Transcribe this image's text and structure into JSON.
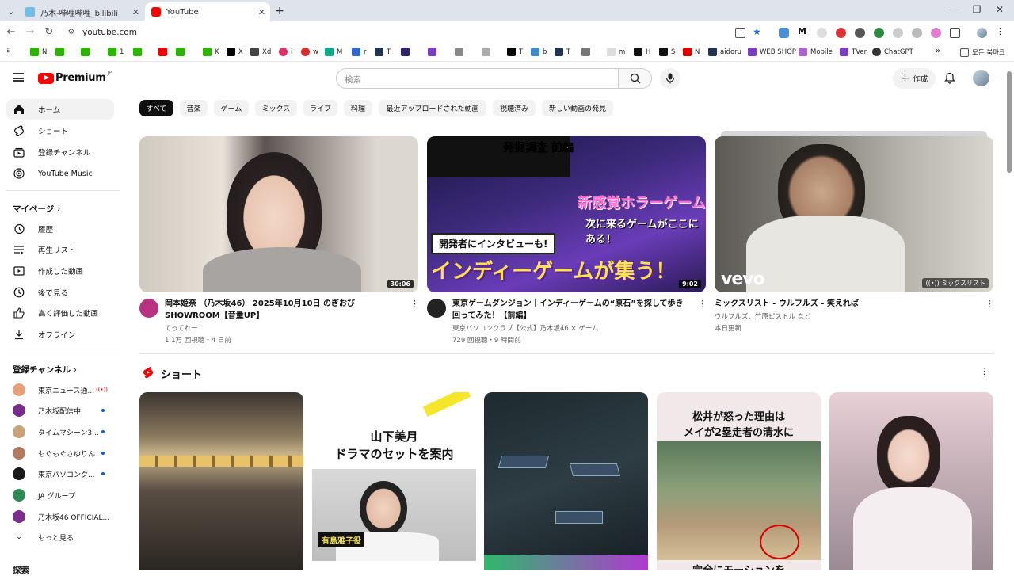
{
  "browser": {
    "tabs": [
      {
        "title": "乃木-哔哩哔哩_bilibili",
        "active": false
      },
      {
        "title": "YouTube",
        "active": true
      }
    ],
    "new_tab": "+",
    "url": "youtube.com",
    "bookmarks": [
      "N",
      "",
      "",
      "",
      "1",
      "",
      "",
      "",
      "K",
      "X",
      "Xd",
      "i",
      "w",
      "M",
      "r",
      "T",
      "",
      "",
      "",
      "",
      "T",
      "b",
      "T",
      "",
      "m",
      "H",
      "S",
      "N",
      "aidoru",
      "WEB SHOP",
      "Mobile",
      "TVer",
      "ChatGPT"
    ],
    "bookmarks_more": "»",
    "other_bookmarks": "모든 북마크"
  },
  "header": {
    "logo": "Premium",
    "logo_region": "JP",
    "search_placeholder": "検索",
    "create_label": "作成"
  },
  "sidebar": {
    "main": [
      {
        "label": "ホーム",
        "icon": "home-icon",
        "active": true
      },
      {
        "label": "ショート",
        "icon": "shorts-icon",
        "active": false
      },
      {
        "label": "登録チャンネル",
        "icon": "subscriptions-icon",
        "active": false
      },
      {
        "label": "YouTube Music",
        "icon": "music-icon",
        "active": false
      }
    ],
    "mypage_heading": "マイページ",
    "mypage": [
      {
        "label": "履歴",
        "icon": "history-icon"
      },
      {
        "label": "再生リスト",
        "icon": "playlist-icon"
      },
      {
        "label": "作成した動画",
        "icon": "your-videos-icon"
      },
      {
        "label": "後で見る",
        "icon": "watch-later-icon"
      },
      {
        "label": "高く評価した動画",
        "icon": "liked-icon"
      },
      {
        "label": "オフライン",
        "icon": "download-icon"
      }
    ],
    "subs_heading": "登録チャンネル",
    "subs": [
      {
        "label": "東京ニュース通...",
        "badge": "live",
        "color": "#e8a07a"
      },
      {
        "label": "乃木坂配信中",
        "badge": "dot",
        "color": "#7b2d8e"
      },
      {
        "label": "タイムマシーン3...",
        "badge": "dot",
        "color": "#c9a27a"
      },
      {
        "label": "もぐもぐさゆりん...",
        "badge": "dot",
        "color": "#b07a60"
      },
      {
        "label": "東京パソコンク...",
        "badge": "dot",
        "color": "#1a1a1a"
      },
      {
        "label": "JA グループ",
        "badge": "",
        "color": "#2e8b57"
      },
      {
        "label": "乃木坂46 OFFICIAL...",
        "badge": "",
        "color": "#7b2d8e"
      },
      {
        "label": "もっと見る",
        "badge": "",
        "color": ""
      }
    ],
    "explore_heading": "探索"
  },
  "chips": [
    "すべて",
    "音楽",
    "ゲーム",
    "ミックス",
    "ライブ",
    "料理",
    "最近アップロードされた動画",
    "視聴済み",
    "新しい動画の発見"
  ],
  "videos": [
    {
      "title": "岡本姫奈 （乃木坂46） 2025年10月10日 のぎおび SHOWROOM【音量UP】",
      "channel": "てってれー",
      "meta": "1.1万 回視聴・4 日前",
      "duration": "30:06"
    },
    {
      "title": "東京ゲームダンジョン｜インディーゲームの“原石”を探して歩き回ってみた！【前編】",
      "channel": "東京パソコンクラブ【公式】乃木坂46 × ゲーム",
      "meta": "729 回視聴・9 時間前",
      "duration": "9:02",
      "thumb_caption_top": "発掘調査 前編",
      "thumb_caption_mid": "新感覚ホラーゲーム",
      "thumb_caption_mid2": "次に来るゲームがここにある！",
      "thumb_caption_box": "開発者にインタビューも!",
      "thumb_caption_bottom": "インディーゲームが集う！"
    },
    {
      "title": "ミックスリスト - ウルフルズ - 笑えれば",
      "channel": "ウルフルズ、竹原ピストル など",
      "meta": "本日更新",
      "duration": "ミックスリスト",
      "thumb_logo": "vevo"
    }
  ],
  "shorts": {
    "heading": "ショート",
    "items": [
      {
        "caption": ""
      },
      {
        "caption": "山下美月\nドラマのセットを案内",
        "sub": "有島雅子役"
      },
      {
        "caption": ""
      },
      {
        "caption": "松井が怒った理由は\nメイが2塁走者の清水に",
        "bottom": "完全にモーションを"
      },
      {
        "caption": ""
      }
    ]
  }
}
